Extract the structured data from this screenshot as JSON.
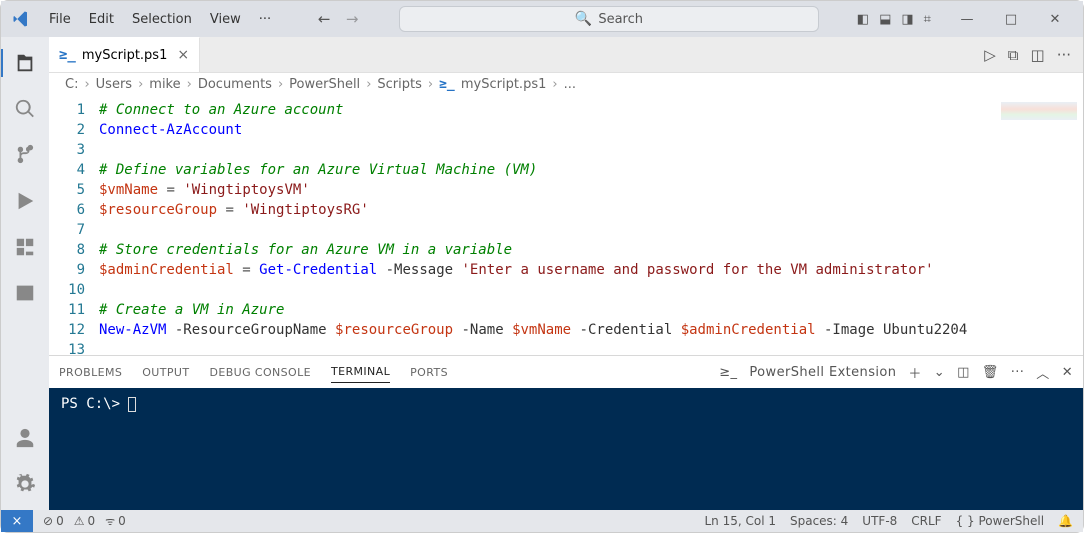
{
  "menubar": {
    "items": [
      "File",
      "Edit",
      "Selection",
      "View"
    ],
    "overflow": "···"
  },
  "search": {
    "placeholder": "Search"
  },
  "tab": {
    "filename": "myScript.ps1"
  },
  "breadcrumbs": {
    "root": "C:",
    "parts": [
      "Users",
      "mike",
      "Documents",
      "PowerShell",
      "Scripts"
    ],
    "file": "myScript.ps1",
    "tail": "..."
  },
  "code": {
    "line_numbers": [
      "1",
      "2",
      "3",
      "4",
      "5",
      "6",
      "7",
      "8",
      "9",
      "10",
      "11",
      "12",
      "13"
    ],
    "lines": [
      {
        "t": "com",
        "text": "# Connect to an Azure account"
      },
      {
        "t": "cmd",
        "text": "Connect-AzAccount"
      },
      {
        "t": "blank",
        "text": ""
      },
      {
        "t": "com",
        "text": "# Define variables for an Azure Virtual Machine (VM)"
      },
      {
        "t": "assign",
        "var": "$vmName",
        "str": "'WingtiptoysVM'"
      },
      {
        "t": "assign",
        "var": "$resourceGroup",
        "str": "'WingtiptoysRG'"
      },
      {
        "t": "blank",
        "text": ""
      },
      {
        "t": "com",
        "text": "# Store credentials for an Azure VM in a variable"
      },
      {
        "t": "cred",
        "var": "$adminCredential",
        "cmd": "Get-Credential",
        "param": "-Message",
        "str": "'Enter a username and password for the VM administrator'"
      },
      {
        "t": "blank",
        "text": ""
      },
      {
        "t": "com",
        "text": "# Create a VM in Azure"
      },
      {
        "t": "vm",
        "cmd": "New-AzVM",
        "p1": "-ResourceGroupName",
        "v1": "$resourceGroup",
        "p2": "-Name",
        "v2": "$vmName",
        "p3": "-Credential",
        "v3": "$adminCredential",
        "p4": "-Image",
        "v4": "Ubuntu2204"
      },
      {
        "t": "blank",
        "text": ""
      }
    ]
  },
  "panel": {
    "tabs": {
      "problems": "Problems",
      "output": "Output",
      "debug": "Debug Console",
      "terminal": "Terminal",
      "ports": "Ports"
    },
    "shell_label": "PowerShell Extension",
    "prompt": "PS C:\\> "
  },
  "statusbar": {
    "errors": "0",
    "warnings": "0",
    "ports": "0",
    "position": "Ln 15, Col 1",
    "spaces": "Spaces: 4",
    "encoding": "UTF-8",
    "eol": "CRLF",
    "lang": "{ } PowerShell"
  }
}
